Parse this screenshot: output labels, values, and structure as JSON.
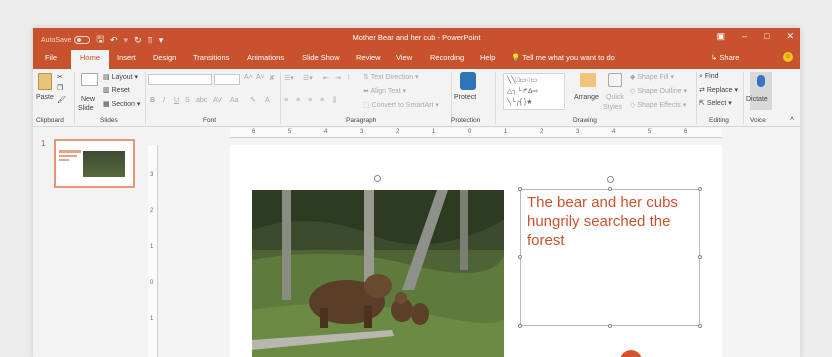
{
  "titlebar": {
    "autosave_label": "AutoSave",
    "autosave_state": "Off",
    "document_title": "Mother Bear and her cub - PowerPoint",
    "accent_color": "#c9522e"
  },
  "tabs": [
    "File",
    "Home",
    "Insert",
    "Design",
    "Transitions",
    "Animations",
    "Slide Show",
    "Review",
    "View",
    "Recording",
    "Help"
  ],
  "active_tab": "Home",
  "tell_me": "Tell me what you want to do",
  "share_label": "Share",
  "ribbon": {
    "clipboard": {
      "paste": "Paste",
      "label": "Clipboard"
    },
    "slides": {
      "new_slide_1": "New",
      "new_slide_2": "Slide",
      "layout": "Layout",
      "reset": "Reset",
      "section": "Section",
      "label": "Slides"
    },
    "font": {
      "bold": "B",
      "italic": "I",
      "underline": "U",
      "strike": "S",
      "shadow": "abc",
      "spacing": "AV",
      "case": "Aa",
      "font_color": "A",
      "label": "Font"
    },
    "paragraph": {
      "text_direction": "Text Direction",
      "align_text": "Align Text",
      "convert_smartart": "Convert to SmartArt",
      "label": "Paragraph"
    },
    "protection": {
      "protect": "Protect",
      "label": "Protection"
    },
    "drawing": {
      "arrange": "Arrange",
      "quick_styles_1": "Quick",
      "quick_styles_2": "Styles",
      "shape_fill": "Shape Fill",
      "shape_outline": "Shape Outline",
      "shape_effects": "Shape Effects",
      "label": "Drawing"
    },
    "editing": {
      "find": "Find",
      "replace": "Replace",
      "select": "Select",
      "label": "Editing"
    },
    "voice": {
      "dictate": "Dictate",
      "label": "Voice"
    }
  },
  "ruler_top": [
    "6",
    "5",
    "4",
    "3",
    "2",
    "1",
    "0",
    "1",
    "2",
    "3",
    "4",
    "5",
    "6"
  ],
  "ruler_left": [
    "3",
    "2",
    "1",
    "0",
    "1"
  ],
  "thumbnail": {
    "number": "1"
  },
  "slide": {
    "textbox_text": "The bear and her cubs hungrily searched the forest"
  }
}
